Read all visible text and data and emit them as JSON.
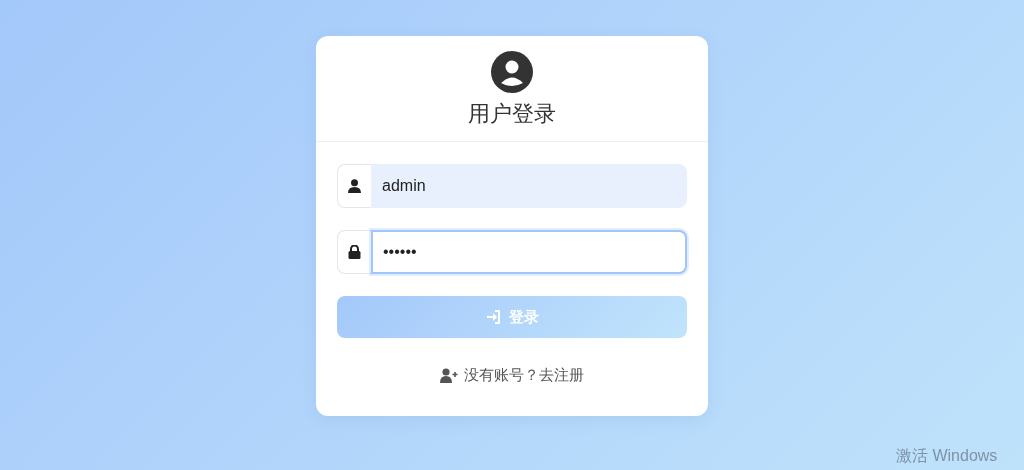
{
  "login_card": {
    "title": "用户登录",
    "fields": [
      {
        "kind": "username",
        "value": "admin",
        "autofilled": true,
        "focused": false
      },
      {
        "kind": "password",
        "value": "••••••",
        "autofilled": false,
        "focused": true
      }
    ],
    "submit_button": {
      "label": "登录"
    },
    "register_link": {
      "label": "没有账号？去注册"
    }
  },
  "os_watermark": {
    "text": "激活 Windows"
  }
}
